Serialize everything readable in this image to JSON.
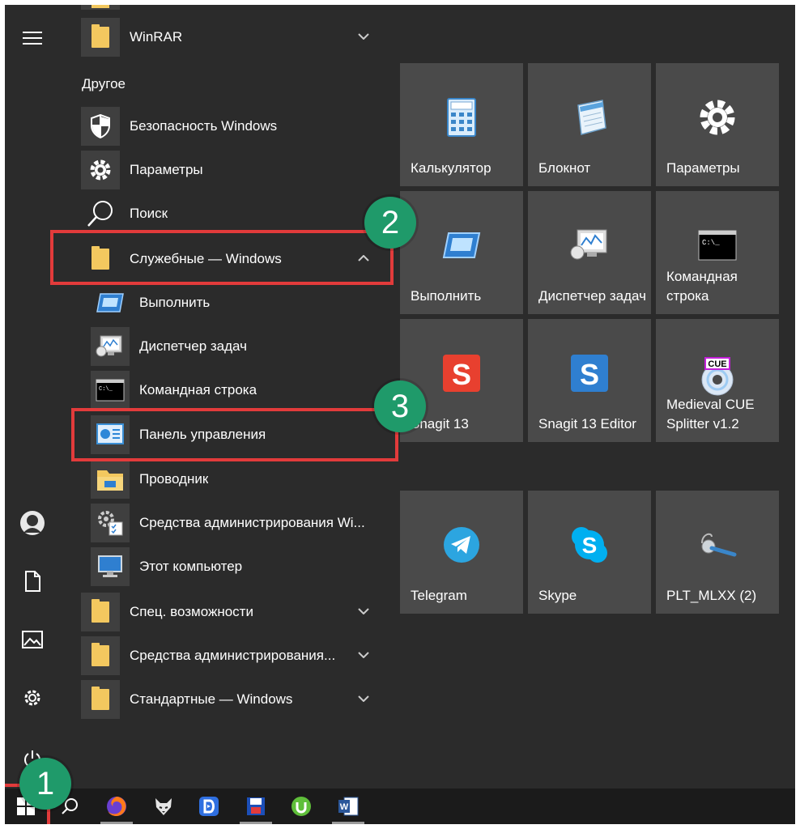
{
  "start_menu": {
    "section_other": "Другое",
    "apps_top": [
      {
        "label": "WinRAR",
        "icon": "folder-icon",
        "expand": "collapsed"
      },
      {
        "label": "Безопасность Windows",
        "icon": "shield-icon"
      },
      {
        "label": "Параметры",
        "icon": "gear-icon"
      },
      {
        "label": "Поиск",
        "icon": "search-icon"
      },
      {
        "label": "Служебные — Windows",
        "icon": "folder-icon",
        "expand": "expanded"
      }
    ],
    "tools_children": [
      {
        "label": "Выполнить",
        "icon": "run-icon"
      },
      {
        "label": "Диспетчер задач",
        "icon": "task-manager-icon"
      },
      {
        "label": "Командная строка",
        "icon": "cmd-icon"
      },
      {
        "label": "Панель управления",
        "icon": "control-panel-icon"
      },
      {
        "label": "Проводник",
        "icon": "explorer-icon"
      },
      {
        "label": "Средства администрирования Wi...",
        "icon": "admin-tools-icon"
      },
      {
        "label": "Этот компьютер",
        "icon": "computer-icon"
      }
    ],
    "apps_bottom": [
      {
        "label": "Спец. возможности",
        "icon": "folder-icon"
      },
      {
        "label": "Средства администрирования...",
        "icon": "folder-icon"
      },
      {
        "label": "Стандартные — Windows",
        "icon": "folder-icon"
      }
    ]
  },
  "tiles": [
    {
      "label": "Калькулятор",
      "icon": "calculator-icon"
    },
    {
      "label": "Блокнот",
      "icon": "notepad-icon"
    },
    {
      "label": "Параметры",
      "icon": "gear-icon"
    },
    {
      "label": "Выполнить",
      "icon": "run-icon"
    },
    {
      "label": "Диспетчер задач",
      "icon": "task-manager-icon"
    },
    {
      "label": "Командная строка",
      "icon": "cmd-icon"
    },
    {
      "label": "Snagit 13",
      "icon": "snagit-icon"
    },
    {
      "label": "Snagit 13 Editor",
      "icon": "snagit-editor-icon"
    },
    {
      "label": "Medieval CUE Splitter v1.2",
      "icon": "cue-splitter-icon",
      "badge_text": "CUE"
    },
    {
      "label": "Telegram",
      "icon": "telegram-icon"
    },
    {
      "label": "Skype",
      "icon": "skype-icon"
    },
    {
      "label": "PLT_MLXX (2)",
      "icon": "headset-icon"
    }
  ],
  "rail": [
    "menu-icon",
    "avatar",
    "document-icon",
    "pictures-icon",
    "settings-icon",
    "power-icon"
  ],
  "taskbar": [
    "start-icon",
    "search-icon",
    "firefox-icon",
    "fox-icon",
    "d-app-icon",
    "floppy-icon",
    "utorrent-icon",
    "word-icon"
  ],
  "callouts": [
    "1",
    "2",
    "3"
  ],
  "colors": {
    "background": "#2b2b2b",
    "tile": "#4a4a4a",
    "highlight": "#e23b3b",
    "badge": "#1f9a6a",
    "folder": "#f3c85f"
  }
}
